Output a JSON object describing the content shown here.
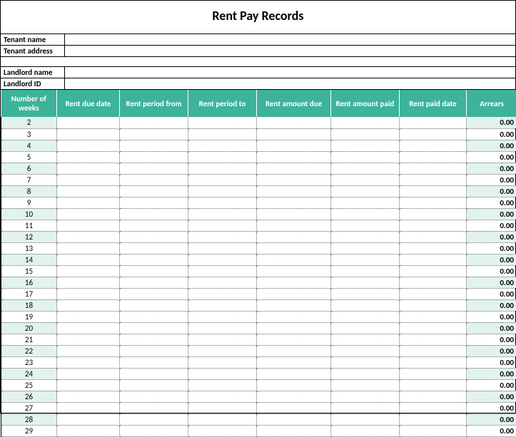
{
  "title": "Rent Pay Records",
  "info": {
    "tenant_name_label": "Tenant name",
    "tenant_name_value": "",
    "tenant_address_label": "Tenant address",
    "tenant_address_value": "",
    "landlord_name_label": "Landlord name",
    "landlord_name_value": "",
    "landlord_id_label": "Landlord ID",
    "landlord_id_value": ""
  },
  "table": {
    "headers": [
      "Number of weeks",
      "Rent due date",
      "Rent period from",
      "Rent period to",
      "Rent amount due",
      "Rent amount paid",
      "Rent paid date",
      "Arrears"
    ],
    "rows": [
      {
        "week": "2",
        "due": "",
        "from": "",
        "to": "",
        "amt_due": "",
        "amt_paid": "",
        "paid_date": "",
        "arrears": "0.00"
      },
      {
        "week": "3",
        "due": "",
        "from": "",
        "to": "",
        "amt_due": "",
        "amt_paid": "",
        "paid_date": "",
        "arrears": "0.00"
      },
      {
        "week": "4",
        "due": "",
        "from": "",
        "to": "",
        "amt_due": "",
        "amt_paid": "",
        "paid_date": "",
        "arrears": "0.00"
      },
      {
        "week": "5",
        "due": "",
        "from": "",
        "to": "",
        "amt_due": "",
        "amt_paid": "",
        "paid_date": "",
        "arrears": "0.00"
      },
      {
        "week": "6",
        "due": "",
        "from": "",
        "to": "",
        "amt_due": "",
        "amt_paid": "",
        "paid_date": "",
        "arrears": "0.00"
      },
      {
        "week": "7",
        "due": "",
        "from": "",
        "to": "",
        "amt_due": "",
        "amt_paid": "",
        "paid_date": "",
        "arrears": "0.00"
      },
      {
        "week": "8",
        "due": "",
        "from": "",
        "to": "",
        "amt_due": "",
        "amt_paid": "",
        "paid_date": "",
        "arrears": "0.00"
      },
      {
        "week": "9",
        "due": "",
        "from": "",
        "to": "",
        "amt_due": "",
        "amt_paid": "",
        "paid_date": "",
        "arrears": "0.00"
      },
      {
        "week": "10",
        "due": "",
        "from": "",
        "to": "",
        "amt_due": "",
        "amt_paid": "",
        "paid_date": "",
        "arrears": "0.00"
      },
      {
        "week": "11",
        "due": "",
        "from": "",
        "to": "",
        "amt_due": "",
        "amt_paid": "",
        "paid_date": "",
        "arrears": "0.00"
      },
      {
        "week": "12",
        "due": "",
        "from": "",
        "to": "",
        "amt_due": "",
        "amt_paid": "",
        "paid_date": "",
        "arrears": "0.00"
      },
      {
        "week": "13",
        "due": "",
        "from": "",
        "to": "",
        "amt_due": "",
        "amt_paid": "",
        "paid_date": "",
        "arrears": "0.00"
      },
      {
        "week": "14",
        "due": "",
        "from": "",
        "to": "",
        "amt_due": "",
        "amt_paid": "",
        "paid_date": "",
        "arrears": "0.00"
      },
      {
        "week": "15",
        "due": "",
        "from": "",
        "to": "",
        "amt_due": "",
        "amt_paid": "",
        "paid_date": "",
        "arrears": "0.00"
      },
      {
        "week": "16",
        "due": "",
        "from": "",
        "to": "",
        "amt_due": "",
        "amt_paid": "",
        "paid_date": "",
        "arrears": "0.00"
      },
      {
        "week": "17",
        "due": "",
        "from": "",
        "to": "",
        "amt_due": "",
        "amt_paid": "",
        "paid_date": "",
        "arrears": "0.00"
      },
      {
        "week": "18",
        "due": "",
        "from": "",
        "to": "",
        "amt_due": "",
        "amt_paid": "",
        "paid_date": "",
        "arrears": "0.00"
      },
      {
        "week": "19",
        "due": "",
        "from": "",
        "to": "",
        "amt_due": "",
        "amt_paid": "",
        "paid_date": "",
        "arrears": "0.00"
      },
      {
        "week": "20",
        "due": "",
        "from": "",
        "to": "",
        "amt_due": "",
        "amt_paid": "",
        "paid_date": "",
        "arrears": "0.00"
      },
      {
        "week": "21",
        "due": "",
        "from": "",
        "to": "",
        "amt_due": "",
        "amt_paid": "",
        "paid_date": "",
        "arrears": "0.00"
      },
      {
        "week": "22",
        "due": "",
        "from": "",
        "to": "",
        "amt_due": "",
        "amt_paid": "",
        "paid_date": "",
        "arrears": "0.00"
      },
      {
        "week": "23",
        "due": "",
        "from": "",
        "to": "",
        "amt_due": "",
        "amt_paid": "",
        "paid_date": "",
        "arrears": "0.00"
      },
      {
        "week": "24",
        "due": "",
        "from": "",
        "to": "",
        "amt_due": "",
        "amt_paid": "",
        "paid_date": "",
        "arrears": "0.00"
      },
      {
        "week": "25",
        "due": "",
        "from": "",
        "to": "",
        "amt_due": "",
        "amt_paid": "",
        "paid_date": "",
        "arrears": "0.00"
      },
      {
        "week": "26",
        "due": "",
        "from": "",
        "to": "",
        "amt_due": "",
        "amt_paid": "",
        "paid_date": "",
        "arrears": "0.00"
      },
      {
        "week": "27",
        "due": "",
        "from": "",
        "to": "",
        "amt_due": "",
        "amt_paid": "",
        "paid_date": "",
        "arrears": "0.00"
      },
      {
        "week": "28",
        "due": "",
        "from": "",
        "to": "",
        "amt_due": "",
        "amt_paid": "",
        "paid_date": "",
        "arrears": "0.00"
      },
      {
        "week": "29",
        "due": "",
        "from": "",
        "to": "",
        "amt_due": "",
        "amt_paid": "",
        "paid_date": "",
        "arrears": "0.00"
      }
    ]
  }
}
